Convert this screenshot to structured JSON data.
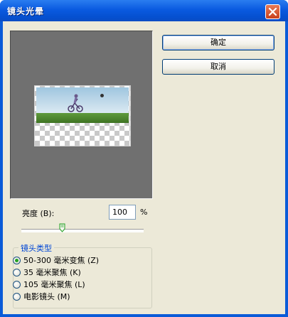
{
  "window": {
    "title": "镜头光晕"
  },
  "buttons": {
    "ok": "确定",
    "cancel": "取消"
  },
  "brightness": {
    "label": "亮度 (B):",
    "value": "100",
    "unit": "%",
    "slider_level": 0.33
  },
  "lens_type": {
    "legend": "镜头类型",
    "options": [
      {
        "label": "50-300 毫米变焦 (Z)",
        "checked": true
      },
      {
        "label": "35 毫米聚焦 (K)",
        "checked": false
      },
      {
        "label": "105 毫米聚焦 (L)",
        "checked": false
      },
      {
        "label": "电影镜头 (M)",
        "checked": false
      }
    ]
  },
  "colors": {
    "title_bar": "#0a5ae0",
    "client_bg": "#ece9d8",
    "preview_bg": "#707070",
    "legend_text": "#0046d5"
  }
}
